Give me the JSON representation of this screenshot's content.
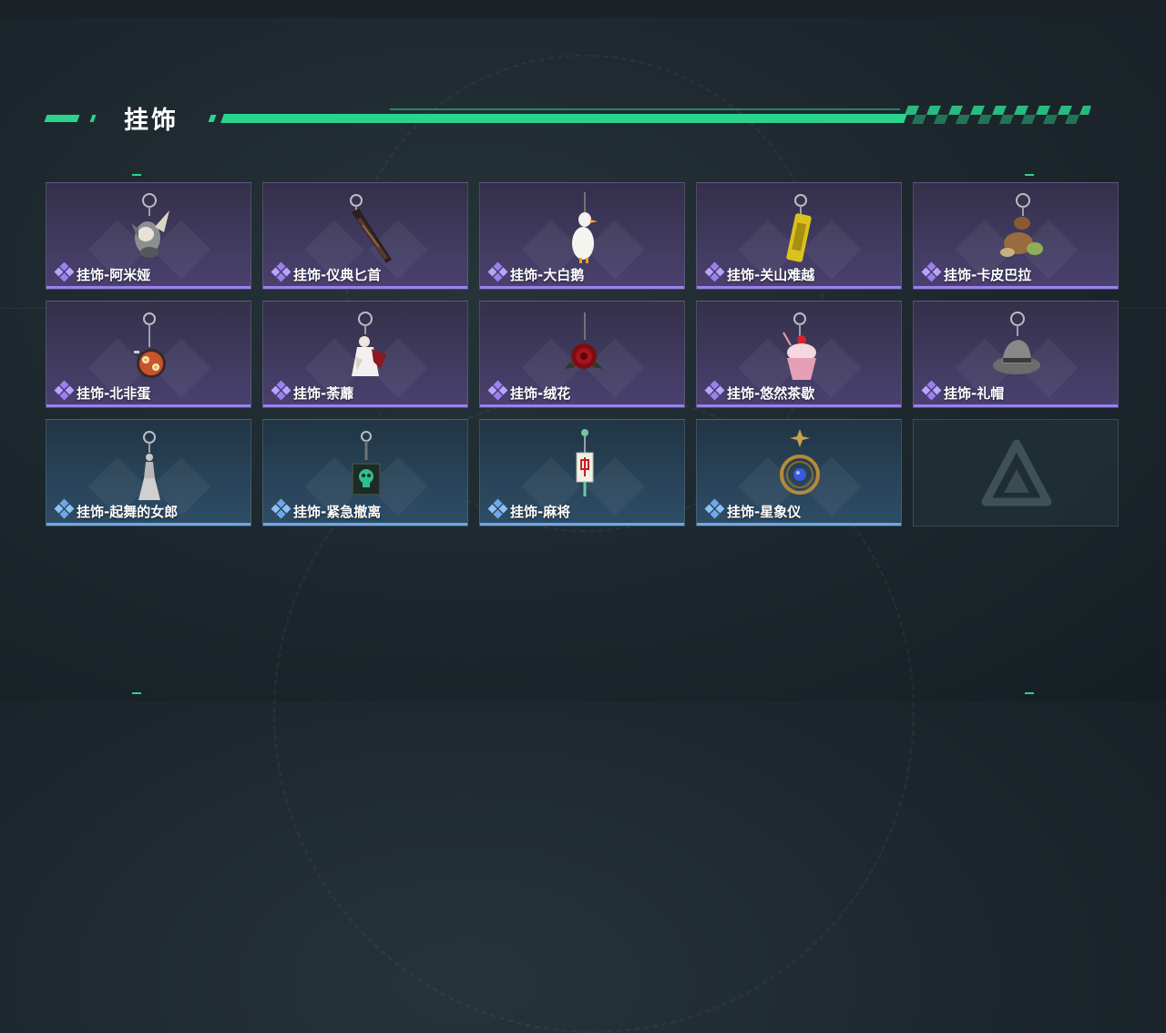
{
  "section": {
    "title": "挂饰"
  },
  "items": [
    {
      "name": "挂饰-阿米娅",
      "rarity": "purple",
      "icon": "amiya-rabbit-charm-icon"
    },
    {
      "name": "挂饰-仪典匕首",
      "rarity": "purple",
      "icon": "ceremonial-dagger-charm-icon"
    },
    {
      "name": "挂饰-大白鹅",
      "rarity": "purple",
      "icon": "white-goose-charm-icon"
    },
    {
      "name": "挂饰-关山难越",
      "rarity": "purple",
      "icon": "yellow-can-charm-icon"
    },
    {
      "name": "挂饰-卡皮巴拉",
      "rarity": "purple",
      "icon": "capybara-charm-icon"
    },
    {
      "name": "挂饰-北非蛋",
      "rarity": "purple",
      "icon": "shakshuka-pan-charm-icon"
    },
    {
      "name": "挂饰-荼蘼",
      "rarity": "purple",
      "icon": "doll-charm-icon"
    },
    {
      "name": "挂饰-绒花",
      "rarity": "purple",
      "icon": "red-rose-charm-icon"
    },
    {
      "name": "挂饰-悠然茶歇",
      "rarity": "purple",
      "icon": "cupcake-charm-icon"
    },
    {
      "name": "挂饰-礼帽",
      "rarity": "purple",
      "icon": "fedora-hat-charm-icon"
    },
    {
      "name": "挂饰-起舞的女郎",
      "rarity": "blue",
      "icon": "dancing-lady-charm-icon"
    },
    {
      "name": "挂饰-紧急撤离",
      "rarity": "blue",
      "icon": "green-skull-box-charm-icon"
    },
    {
      "name": "挂饰-麻将",
      "rarity": "blue",
      "icon": "mahjong-tile-charm-icon"
    },
    {
      "name": "挂饰-星象仪",
      "rarity": "blue",
      "icon": "astrolabe-charm-icon"
    }
  ],
  "empty_slot": {
    "icon": "delta-logo-icon"
  },
  "colors": {
    "accent": "#2bd48e",
    "purple_rarity": "#9c7ff0",
    "blue_rarity": "#6ea8e8"
  }
}
